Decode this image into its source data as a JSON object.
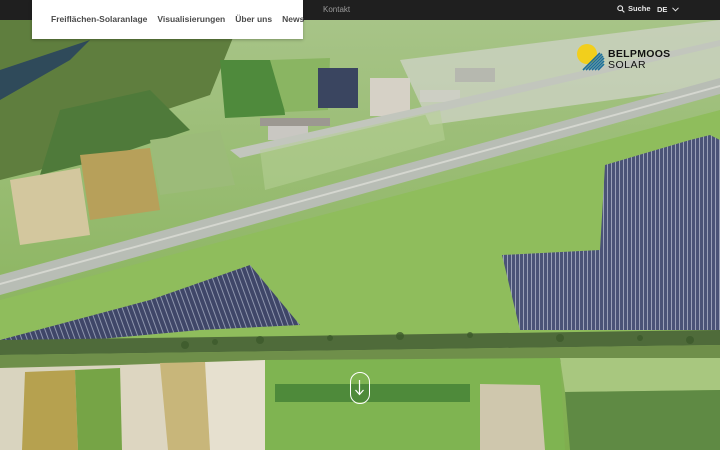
{
  "topbar": {
    "contact_label": "Kontakt",
    "search_label": "Suche",
    "language": "DE"
  },
  "nav": {
    "items": [
      {
        "label": "Freiflächen-Solaranlage"
      },
      {
        "label": "Visualisierungen"
      },
      {
        "label": "Über uns"
      },
      {
        "label": "News"
      }
    ]
  },
  "logo": {
    "line1": "BELPMOOS",
    "line2": "SOLAR",
    "sun_color": "#f2cf1c",
    "stripe_color": "#1c6f9a"
  },
  "hero": {
    "scroll_icon": "arrow-down-icon"
  },
  "colors": {
    "topbar": "#1f1f1f",
    "nav_text": "#4a4a4a",
    "panel": "#4d5578"
  }
}
